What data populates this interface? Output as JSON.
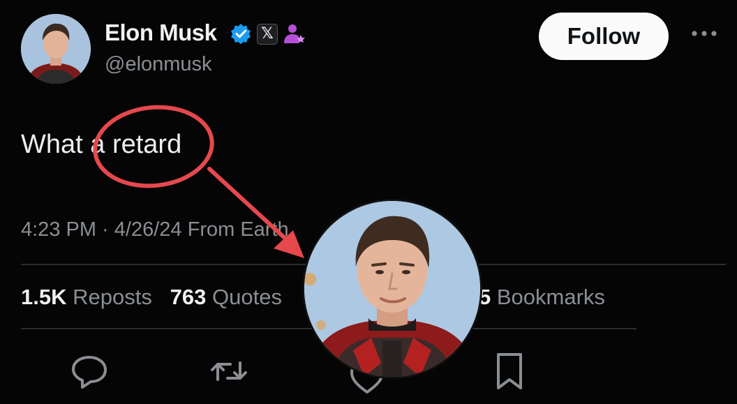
{
  "author": {
    "name": "Elon Musk",
    "handle": "@elonmusk",
    "x_badge": "𝕏"
  },
  "follow_label": "Follow",
  "tweet": {
    "text_before": "What ",
    "text_circled": "a retard"
  },
  "meta": {
    "time": "4:23 PM",
    "sep": " · ",
    "date": "4/26/24",
    "source": " From Earth"
  },
  "stats": {
    "reposts_count": "1.5K",
    "reposts_label": " Reposts",
    "quotes_count": "763",
    "quotes_label": " Quotes",
    "bookmarks_partial": "5",
    "bookmarks_label": " Bookmarks"
  },
  "icons": {
    "reply": "reply-icon",
    "repost": "repost-icon",
    "like": "like-icon",
    "bookmark": "bookmark-icon",
    "more": "more-icon"
  },
  "colors": {
    "annotation_red": "#e5484d",
    "verified_blue": "#1d9bf0",
    "affiliate_purple": "#b54fd6"
  }
}
